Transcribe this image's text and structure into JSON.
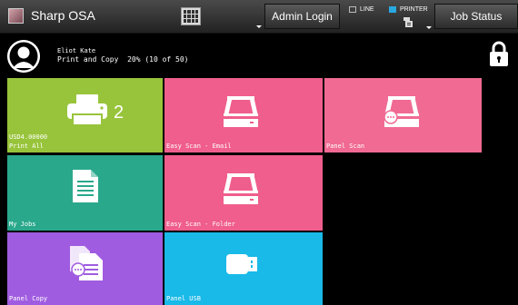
{
  "header": {
    "app_title": "Sharp OSA",
    "admin_label": "Admin Login",
    "line_label": "LINE",
    "printer_label": "PRINTER",
    "job_status_label": "Job Status"
  },
  "user": {
    "name": "Eliot Kate",
    "quota": "Print and Copy  20% (10 of 50)"
  },
  "tiles": [
    {
      "label": "Print All",
      "sub": "USD4.00000",
      "count": "2",
      "color": "#98c43b",
      "icon": "printer-icon"
    },
    {
      "label": "Easy Scan - Email",
      "color": "#ef5e8c",
      "icon": "scanner-icon"
    },
    {
      "label": "Panel Scan",
      "color": "#f06a93",
      "icon": "panel-scan-icon"
    },
    {
      "label": "My Jobs",
      "color": "#2aa88c",
      "icon": "document-icon"
    },
    {
      "label": "Easy Scan - Folder",
      "color": "#ef5e8c",
      "icon": "scanner-icon"
    },
    {
      "label": "Panel Copy",
      "color": "#a05ce0",
      "icon": "copy-icon"
    },
    {
      "label": "Panel USB",
      "color": "#19b9e8",
      "icon": "usb-icon"
    }
  ]
}
